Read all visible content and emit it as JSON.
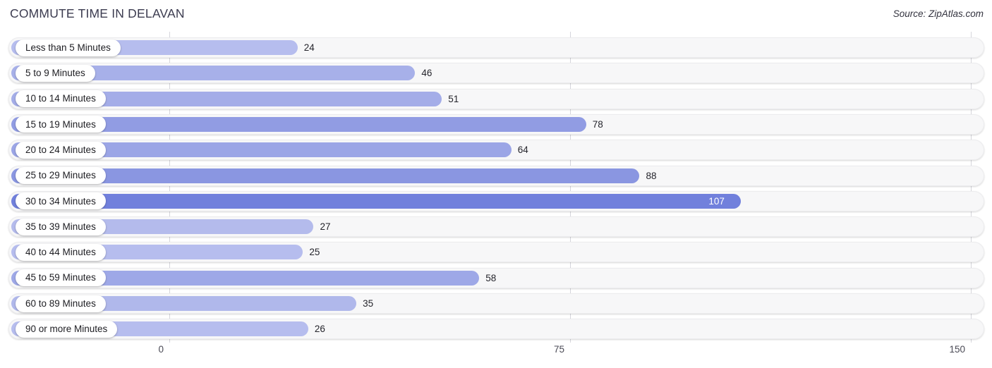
{
  "header": {
    "title": "COMMUTE TIME IN DELAVAN",
    "source": "Source: ZipAtlas.com"
  },
  "colors": {
    "bar_light": "#b4bbec",
    "bar_mid": "#9aa4e6",
    "bar_dark": "#7180dc",
    "track": "#f7f7f8",
    "gridline": "#d6d6dc",
    "text": "#25252c",
    "title": "#3c3c50"
  },
  "axis": {
    "ticks": [
      "0",
      "75",
      "150"
    ],
    "min": 0,
    "max": 150
  },
  "chart_data": {
    "type": "bar",
    "orientation": "horizontal",
    "title": "COMMUTE TIME IN DELAVAN",
    "subtitle": "",
    "xlabel": "",
    "ylabel": "",
    "xlim": [
      0,
      150
    ],
    "xticks": [
      0,
      75,
      150
    ],
    "grid": true,
    "legend": false,
    "source": "Source: ZipAtlas.com",
    "categories": [
      "Less than 5 Minutes",
      "5 to 9 Minutes",
      "10 to 14 Minutes",
      "15 to 19 Minutes",
      "20 to 24 Minutes",
      "25 to 29 Minutes",
      "30 to 34 Minutes",
      "35 to 39 Minutes",
      "40 to 44 Minutes",
      "45 to 59 Minutes",
      "60 to 89 Minutes",
      "90 or more Minutes"
    ],
    "values": [
      24,
      46,
      51,
      78,
      64,
      88,
      107,
      27,
      25,
      58,
      35,
      26
    ],
    "bars": [
      {
        "label": "Less than 5 Minutes",
        "value": 24,
        "value_text": "24",
        "value_inside": false,
        "color": "#b6bdee"
      },
      {
        "label": "5 to 9 Minutes",
        "value": 46,
        "value_text": "46",
        "value_inside": false,
        "color": "#a7b0e9"
      },
      {
        "label": "10 to 14 Minutes",
        "value": 51,
        "value_text": "51",
        "value_inside": false,
        "color": "#a4ade8"
      },
      {
        "label": "15 to 19 Minutes",
        "value": 78,
        "value_text": "78",
        "value_inside": false,
        "color": "#919ce3"
      },
      {
        "label": "20 to 24 Minutes",
        "value": 64,
        "value_text": "64",
        "value_inside": false,
        "color": "#9ba5e6"
      },
      {
        "label": "25 to 29 Minutes",
        "value": 88,
        "value_text": "88",
        "value_inside": false,
        "color": "#8a96e1"
      },
      {
        "label": "30 to 34 Minutes",
        "value": 107,
        "value_text": "107",
        "value_inside": true,
        "color": "#7180dc"
      },
      {
        "label": "35 to 39 Minutes",
        "value": 27,
        "value_text": "27",
        "value_inside": false,
        "color": "#b4bbec"
      },
      {
        "label": "40 to 44 Minutes",
        "value": 25,
        "value_text": "25",
        "value_inside": false,
        "color": "#b6bdee"
      },
      {
        "label": "45 to 59 Minutes",
        "value": 58,
        "value_text": "58",
        "value_inside": false,
        "color": "#9ea8e7"
      },
      {
        "label": "60 to 89 Minutes",
        "value": 35,
        "value_text": "35",
        "value_inside": false,
        "color": "#b0b8eb"
      },
      {
        "label": "90 or more Minutes",
        "value": 26,
        "value_text": "26",
        "value_inside": false,
        "color": "#b6bdee"
      }
    ]
  }
}
